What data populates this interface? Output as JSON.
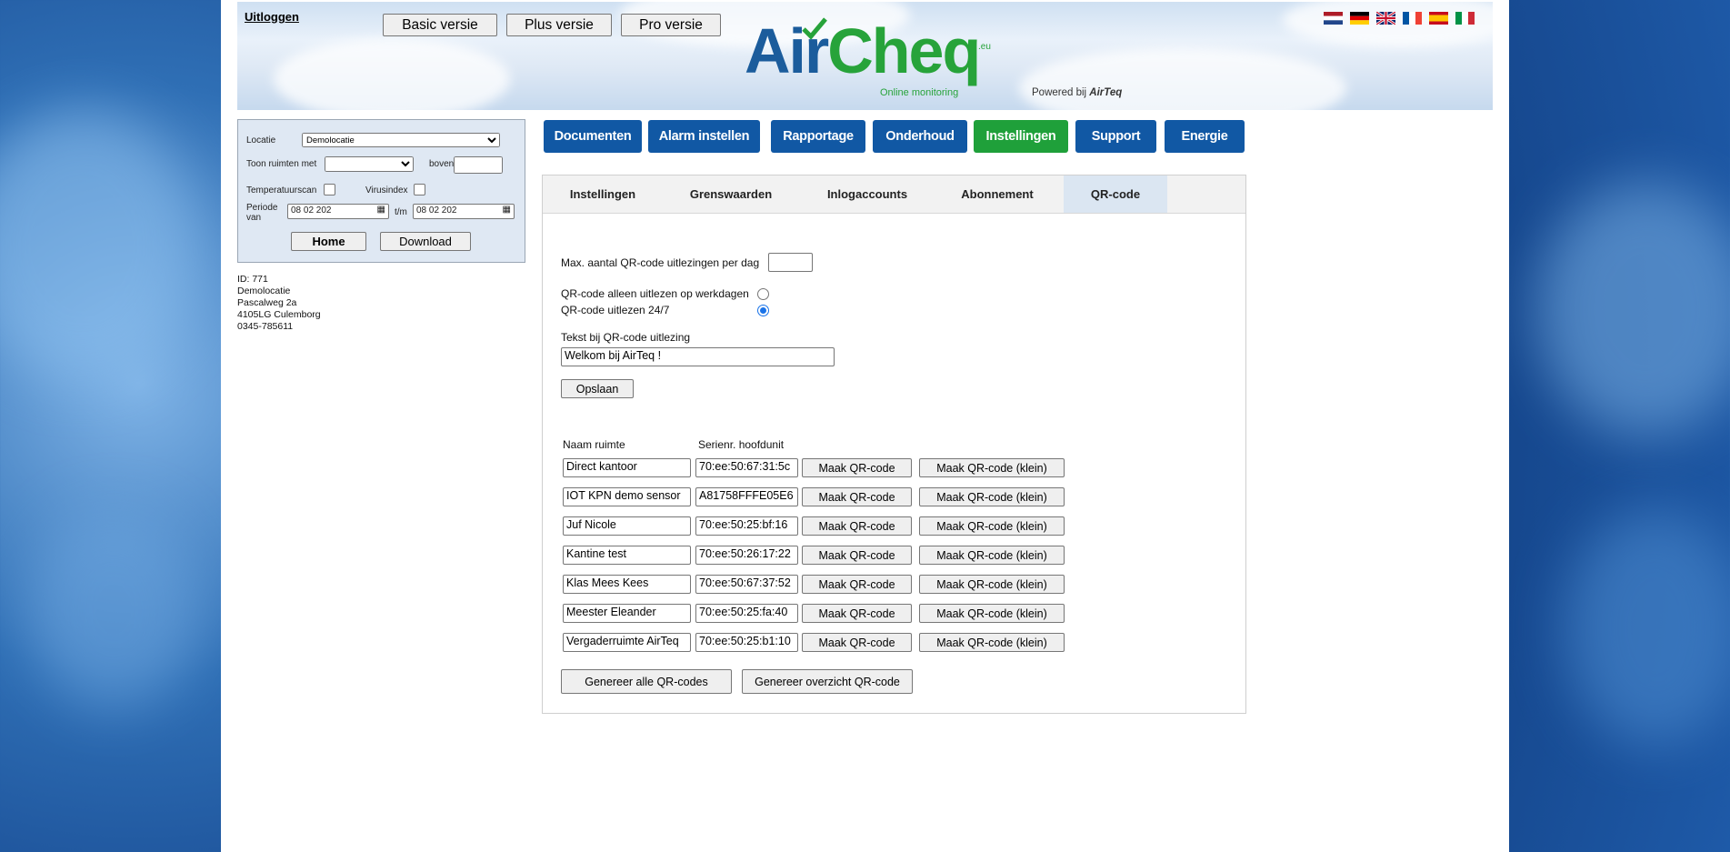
{
  "header": {
    "logout": "Uitloggen",
    "versions": [
      "Basic versie",
      "Plus versie",
      "Pro versie"
    ],
    "logo_air": "Air",
    "logo_cheq": "Cheq",
    "logo_eu": ".eu",
    "logo_sub": "Online monitoring",
    "powered_prefix": "Powered bij",
    "powered_brand": "AirTeq",
    "flags": [
      "flag-nl-icon",
      "flag-de-icon",
      "flag-uk-icon",
      "flag-fr-icon",
      "flag-es-icon",
      "flag-it-icon"
    ]
  },
  "filter": {
    "locatie_label": "Locatie",
    "locatie_value": "Demolocatie",
    "toon_label": "Toon ruimten met",
    "boven_label": "boven",
    "temp_label": "Temperatuurscan",
    "virus_label": "Virusindex",
    "periode_label": "Periode van",
    "tm_label": "t/m",
    "date_from": "08 02 202",
    "date_to": "08 02 202",
    "home": "Home",
    "download": "Download"
  },
  "address": [
    "ID: 771",
    "Demolocatie",
    "Pascalweg 2a",
    "4105LG Culemborg",
    "0345-785611"
  ],
  "nav": [
    {
      "label": "Documenten",
      "color": "#1158a4"
    },
    {
      "label": "Alarm instellen",
      "color": "#1158a4"
    },
    {
      "label": "Rapportage",
      "color": "#1158a4"
    },
    {
      "label": "Onderhoud",
      "color": "#1158a4"
    },
    {
      "label": "Instellingen",
      "color": "#1fa03a"
    },
    {
      "label": "Support",
      "color": "#1158a4"
    },
    {
      "label": "Energie",
      "color": "#1158a4"
    }
  ],
  "tabs": [
    "Instellingen",
    "Grenswaarden",
    "Inlogaccounts",
    "Abonnement",
    "QR-code"
  ],
  "qr": {
    "max_label": "Max. aantal QR-code uitlezingen per dag",
    "max_value": "",
    "radio_workdays": "QR-code alleen uitlezen op werkdagen",
    "radio_247": "QR-code uitlezen 24/7",
    "text_label": "Tekst bij QR-code uitlezing",
    "text_value": "Welkom bij AirTeq !",
    "save": "Opslaan",
    "col_name": "Naam ruimte",
    "col_serial": "Serienr. hoofdunit",
    "make_btn": "Maak QR-code",
    "make_small_btn": "Maak QR-code (klein)",
    "rows": [
      {
        "name": "Direct kantoor",
        "serial": "70:ee:50:67:31:5c"
      },
      {
        "name": "IOT KPN demo sensor",
        "serial": "A81758FFFE05E6"
      },
      {
        "name": "Juf Nicole",
        "serial": "70:ee:50:25:bf:16"
      },
      {
        "name": "Kantine test",
        "serial": "70:ee:50:26:17:22"
      },
      {
        "name": "Klas Mees Kees",
        "serial": "70:ee:50:67:37:52"
      },
      {
        "name": "Meester Eleander",
        "serial": "70:ee:50:25:fa:40"
      },
      {
        "name": "Vergaderruimte AirTeq",
        "serial": "70:ee:50:25:b1:10"
      }
    ],
    "gen_all": "Genereer alle QR-codes",
    "gen_overview": "Genereer overzicht QR-code"
  }
}
